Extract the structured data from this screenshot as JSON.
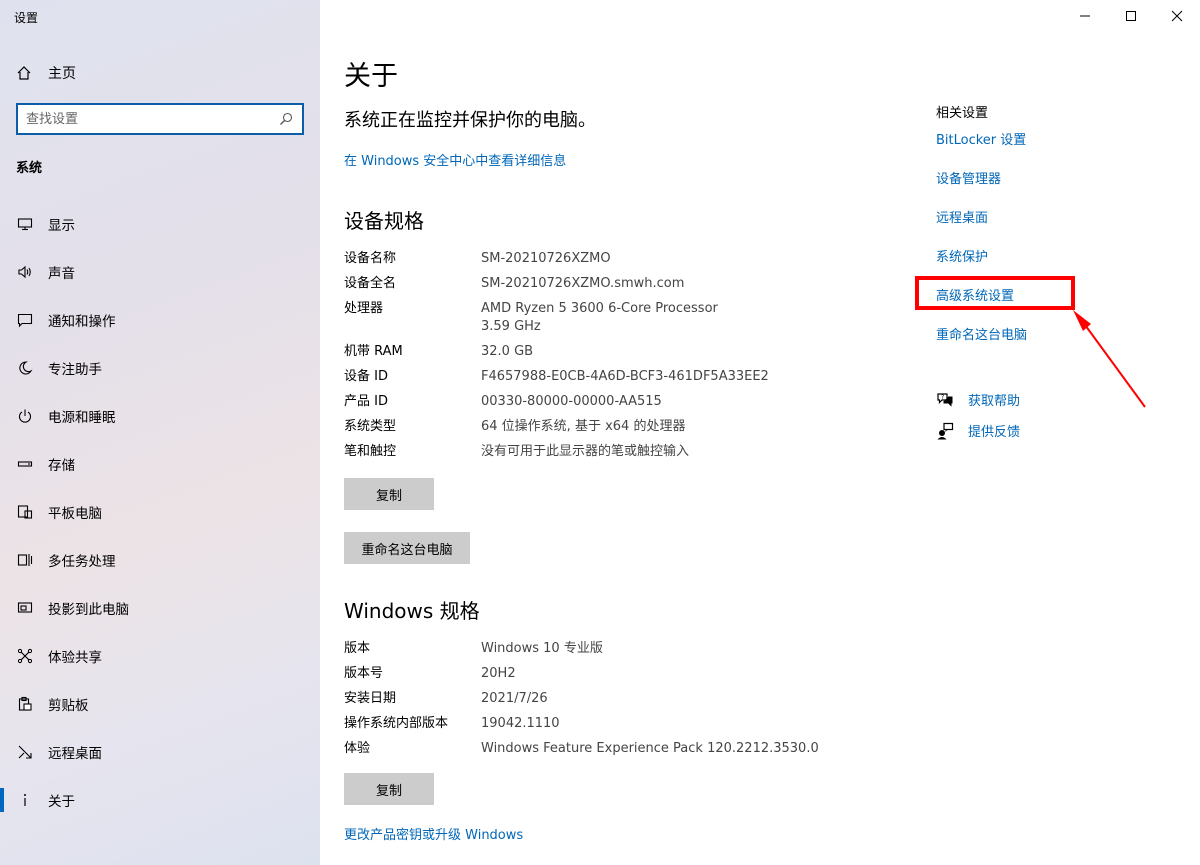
{
  "window": {
    "title": "设置"
  },
  "sidebar": {
    "home_label": "主页",
    "search_placeholder": "查找设置",
    "section": "系统",
    "items": [
      {
        "label": "显示",
        "icon": "display-icon"
      },
      {
        "label": "声音",
        "icon": "speaker-icon"
      },
      {
        "label": "通知和操作",
        "icon": "notification-icon"
      },
      {
        "label": "专注助手",
        "icon": "moon-icon"
      },
      {
        "label": "电源和睡眠",
        "icon": "power-icon"
      },
      {
        "label": "存储",
        "icon": "storage-icon"
      },
      {
        "label": "平板电脑",
        "icon": "tablet-icon"
      },
      {
        "label": "多任务处理",
        "icon": "multitask-icon"
      },
      {
        "label": "投影到此电脑",
        "icon": "projection-icon"
      },
      {
        "label": "体验共享",
        "icon": "share-icon"
      },
      {
        "label": "剪贴板",
        "icon": "clipboard-icon"
      },
      {
        "label": "远程桌面",
        "icon": "remote-desktop-icon"
      },
      {
        "label": "关于",
        "icon": "info-icon",
        "active": true
      }
    ]
  },
  "main": {
    "title": "关于",
    "protect_text": "系统正在监控并保护你的电脑。",
    "security_link": "在 Windows 安全中心中查看详细信息",
    "device_specs": {
      "heading": "设备规格",
      "rows": [
        {
          "key": "设备名称",
          "value": "SM-20210726XZMO"
        },
        {
          "key": "设备全名",
          "value": "SM-20210726XZMO.smwh.com"
        },
        {
          "key": "处理器",
          "value": "AMD Ryzen 5 3600 6-Core Processor",
          "value2": "3.59 GHz"
        },
        {
          "key": "机带 RAM",
          "value": "32.0 GB"
        },
        {
          "key": "设备 ID",
          "value": "F4657988-E0CB-4A6D-BCF3-461DF5A33EE2"
        },
        {
          "key": "产品 ID",
          "value": "00330-80000-00000-AA515"
        },
        {
          "key": "系统类型",
          "value": "64 位操作系统, 基于 x64 的处理器"
        },
        {
          "key": "笔和触控",
          "value": "没有可用于此显示器的笔或触控输入"
        }
      ],
      "copy_label": "复制",
      "rename_label": "重命名这台电脑"
    },
    "windows_specs": {
      "heading": "Windows 规格",
      "rows": [
        {
          "key": "版本",
          "value": "Windows 10 专业版"
        },
        {
          "key": "版本号",
          "value": "20H2"
        },
        {
          "key": "安装日期",
          "value": "2021/7/26"
        },
        {
          "key": "操作系统内部版本",
          "value": "19042.1110"
        },
        {
          "key": "体验",
          "value": "Windows Feature Experience Pack 120.2212.3530.0"
        }
      ],
      "copy_label": "复制"
    },
    "upgrade_link": "更改产品密钥或升级 Windows"
  },
  "related": {
    "title": "相关设置",
    "links": [
      "BitLocker 设置",
      "设备管理器",
      "远程桌面",
      "系统保护",
      "高级系统设置",
      "重命名这台电脑"
    ],
    "help": {
      "label": "获取帮助",
      "icon": "help-chat-icon"
    },
    "feedback": {
      "label": "提供反馈",
      "icon": "feedback-icon"
    }
  },
  "colors": {
    "link": "#0067b8",
    "accent": "#0a5ea8",
    "highlight": "#ff0000"
  }
}
